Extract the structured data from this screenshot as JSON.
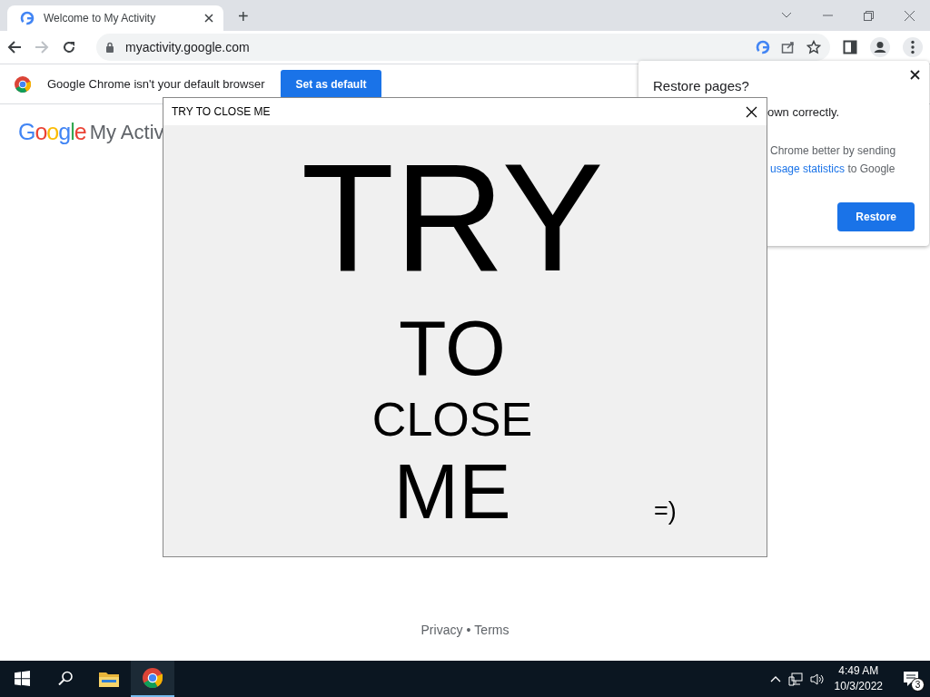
{
  "browser": {
    "tabs": [
      {
        "title": "Welcome to My Activity",
        "selected": true
      }
    ],
    "new_tab": "+",
    "address": "myactivity.google.com",
    "infobar": {
      "message": "Google Chrome isn't your default browser",
      "button": "Set as default"
    },
    "page": {
      "logo": "Google",
      "product": "My Activ",
      "footer": [
        {
          "label": "Privacy"
        },
        {
          "label": "Terms"
        }
      ],
      "separator": "•"
    }
  },
  "restore_bubble": {
    "title": "Restore pages?",
    "line_1": "own correctly.",
    "line_2": "Chrome better by sending",
    "link": "usage statistics",
    "line_3_rest": " to Google",
    "button": "Restore"
  },
  "dialog": {
    "title": "TRY TO CLOSE ME",
    "lines": [
      "TRY",
      "TO",
      "CLOSE",
      "ME"
    ],
    "smiley": "=)"
  },
  "taskbar": {
    "apps": [
      {
        "kind": "files",
        "active": false
      },
      {
        "kind": "chrome",
        "active": true
      }
    ],
    "time": "4:49 AM",
    "date": "10/3/2022",
    "notifications": "3"
  }
}
